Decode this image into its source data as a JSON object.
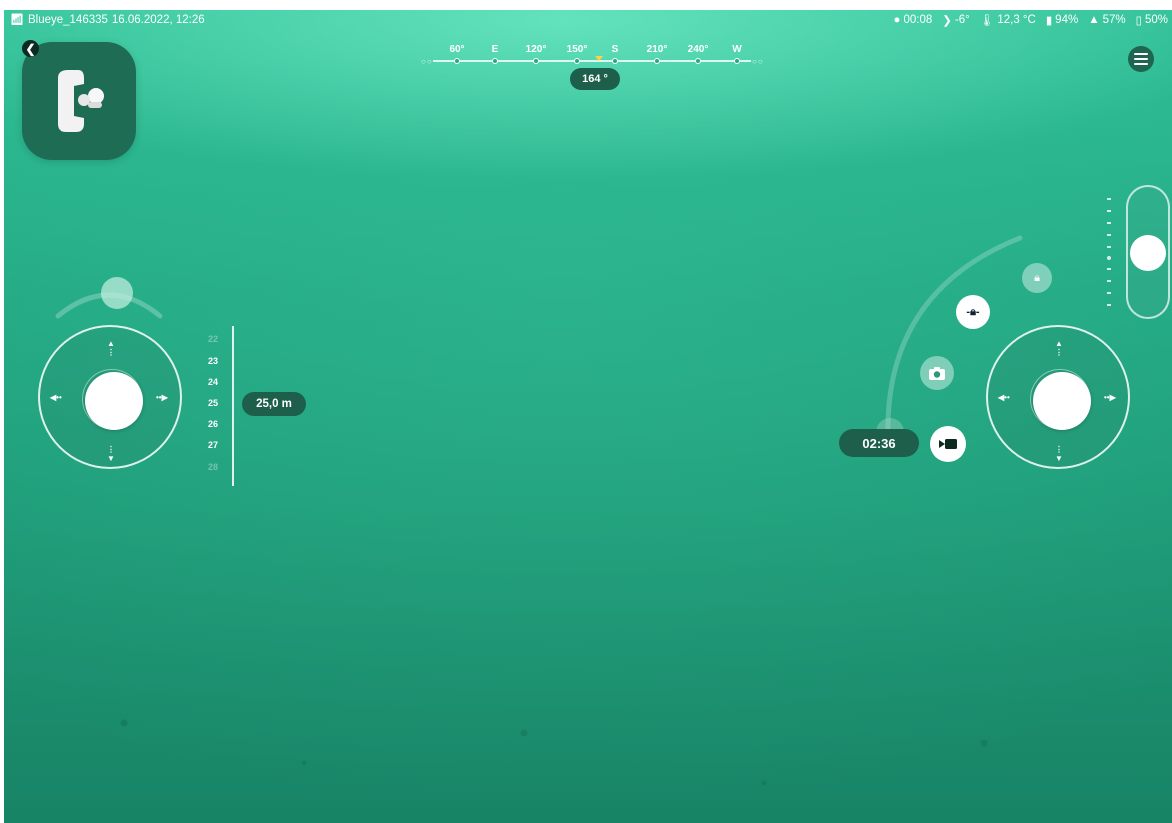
{
  "status_bar": {
    "device_name": "Blueye_146335",
    "datetime": "16.06.2022, 12:26",
    "dive_time": "00:08",
    "tilt": "-6°",
    "water_temp": "12,3 °C",
    "drone_battery": "94%",
    "remote_battery": "57%",
    "tablet_battery": "50%"
  },
  "compass": {
    "labels": [
      "60°",
      "E",
      "120°",
      "150°",
      "S",
      "210°",
      "240°",
      "W"
    ],
    "heading": "164 °"
  },
  "depth": {
    "scale": [
      "22",
      "23",
      "24",
      "25",
      "26",
      "27",
      "28"
    ],
    "current": "25,0 m"
  },
  "recording": {
    "elapsed": "02:36"
  },
  "icons": {
    "back": "chevron-left-icon",
    "menu": "hamburger-menu-icon",
    "camera": "camera-icon",
    "record": "video-camera-icon",
    "lock": "lock-icon"
  },
  "colors": {
    "water": "#22a883",
    "badge": "#1e5f4c",
    "compass_marker": "#ffd23f"
  }
}
